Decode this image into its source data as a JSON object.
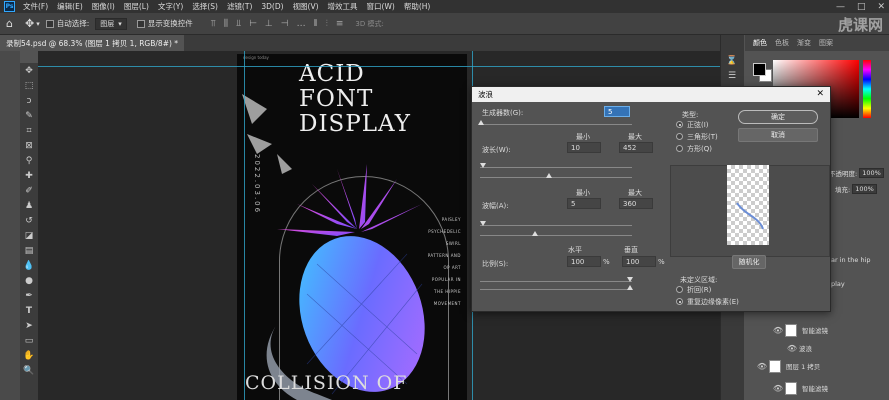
{
  "app": {
    "logo": "Ps",
    "menus": [
      "文件(F)",
      "编辑(E)",
      "图像(I)",
      "图层(L)",
      "文字(Y)",
      "选择(S)",
      "滤镜(T)",
      "3D(D)",
      "视图(V)",
      "增效工具",
      "窗口(W)",
      "帮助(H)"
    ],
    "window_controls": [
      "—",
      "□",
      "✕"
    ]
  },
  "options_bar": {
    "auto_select_label": "自动选择:",
    "auto_select_value": "图层",
    "show_transform_label": "显示变换控件",
    "mode_3d_label": "3D 模式:",
    "watermark": "虎课网"
  },
  "document": {
    "tab_label": "录制54.psd @ 68.3% (图层 1 拷贝 1, RGB/8#) *"
  },
  "poster": {
    "title_lines": [
      "ACID",
      "FONT",
      "DISPLAY"
    ],
    "bottom_text": "COLLISION OF",
    "date_text": "2022.03.06",
    "side_lines": [
      "PAISLEY",
      "PSYCHEDELIC",
      "SWIRL",
      "PATTERN AND",
      "OP ART",
      "POPULAR IN",
      "THE HIPPIE",
      "MOVEMENT"
    ],
    "corner_label": "design today"
  },
  "right_panel": {
    "tabs": [
      "颜色",
      "色板",
      "渐变",
      "图案"
    ],
    "opacity_label": "不透明度:",
    "opacity_value": "100%",
    "fill_label": "填充:",
    "fill_value": "100%",
    "partial_text_1": "ar in the hip",
    "partial_text_2": "play",
    "layers": [
      {
        "name": "智能滤镜"
      },
      {
        "name": "波浪"
      },
      {
        "name": "图层 1 拷贝"
      },
      {
        "name": "智能滤镜"
      }
    ]
  },
  "dialog": {
    "title": "波浪",
    "close": "✕",
    "generators_label": "生成器数(G):",
    "generators_value": "5",
    "wavelength_label": "波长(W):",
    "amplitude_label": "波幅(A):",
    "scale_label": "比例(S):",
    "min_label": "最小",
    "max_label": "最大",
    "horizontal_label": "水平",
    "vertical_label": "垂直",
    "wavelength_min": "10",
    "wavelength_max": "452",
    "amplitude_min": "5",
    "amplitude_max": "360",
    "scale_h": "100",
    "scale_v": "100",
    "percent": "%",
    "type_label": "类型:",
    "type_options": [
      "正弦(I)",
      "三角形(T)",
      "方形(Q)"
    ],
    "type_selected": 0,
    "ok_label": "确定",
    "cancel_label": "取消",
    "randomize_label": "随机化",
    "undefined_area_label": "未定义区域:",
    "undefined_options": [
      "折回(R)",
      "重复边缘像素(E)"
    ],
    "undefined_selected": 1
  }
}
